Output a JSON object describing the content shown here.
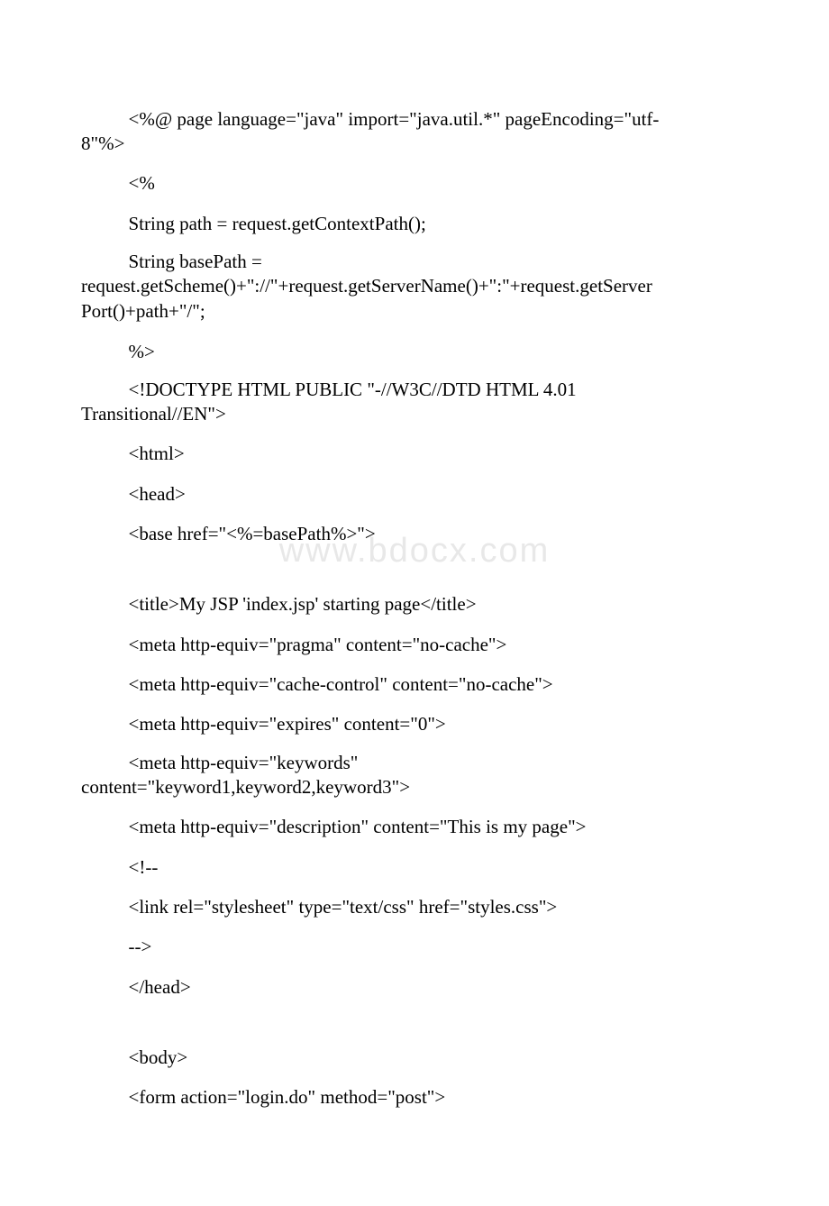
{
  "watermark": "www.bdocx.com",
  "lines": {
    "l1a": "<%@ page language=\"java\" import=\"java.util.*\" pageEncoding=\"utf-",
    "l1b": "8\"%>",
    "l2": "<%",
    "l3": "String path = request.getContextPath();",
    "l4a": "String basePath =",
    "l4b": "request.getScheme()+\"://\"+request.getServerName()+\":\"+request.getServer",
    "l4c": "Port()+path+\"/\";",
    "l5": "%>",
    "l6a": "<!DOCTYPE HTML PUBLIC \"-//W3C//DTD HTML 4.01",
    "l6b": "Transitional//EN\">",
    "l7": "<html>",
    "l8": " <head>",
    "l9": " <base href=\"<%=basePath%>\">",
    "l10": " <title>My JSP 'index.jsp' starting page</title>",
    "l11": " <meta http-equiv=\"pragma\" content=\"no-cache\">",
    "l12": " <meta http-equiv=\"cache-control\" content=\"no-cache\">",
    "l13": " <meta http-equiv=\"expires\" content=\"0\">",
    "l14a": " <meta http-equiv=\"keywords\"",
    "l14b": "content=\"keyword1,keyword2,keyword3\">",
    "l15": " <meta http-equiv=\"description\" content=\"This is my page\">",
    "l16": " <!--",
    "l17": " <link rel=\"stylesheet\" type=\"text/css\" href=\"styles.css\">",
    "l18": " -->",
    "l19": " </head>",
    "l20": " <body>",
    "l21": "<form action=\"login.do\" method=\"post\">"
  }
}
